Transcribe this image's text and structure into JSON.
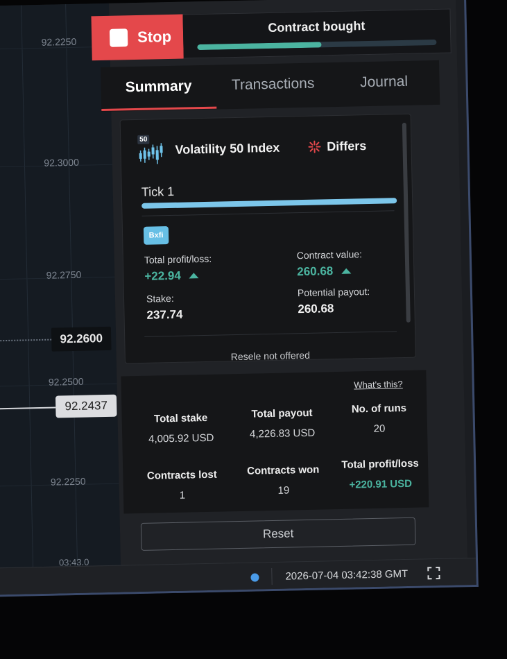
{
  "chart": {
    "price_ticks": [
      "92.2250",
      "92.3000",
      "92.2750",
      "92.2500",
      "92.2250"
    ],
    "current_price": "92.2600",
    "spot_price": "92.2437",
    "time_tick": "03:43.0"
  },
  "topbar": {
    "stop_label": "Stop",
    "status_text": "Contract bought",
    "progress": 0.52
  },
  "tabs": [
    {
      "label": "Summary",
      "active": true
    },
    {
      "label": "Transactions",
      "active": false
    },
    {
      "label": "Journal",
      "active": false
    }
  ],
  "contract": {
    "asset_badge": "50",
    "asset_name": "Volatility 50 Index",
    "trade_type": "Differs",
    "tick_label": "Tick 1",
    "type_chip": "Bxfi",
    "total_profit_label": "Total profit/loss:",
    "total_profit_value": "+22.94",
    "contract_value_label": "Contract value:",
    "contract_value": "260.68",
    "stake_label": "Stake:",
    "stake_value": "237.74",
    "payout_label": "Potential payout:",
    "payout_value": "260.68",
    "resale_text": "Resele not offered"
  },
  "stats": {
    "whats_this": "What's this?",
    "total_stake_label": "Total stake",
    "total_stake_value": "4,005.92 USD",
    "total_payout_label": "Total payout",
    "total_payout_value": "4,226.83 USD",
    "runs_label": "No. of runs",
    "runs_value": "20",
    "lost_label": "Contracts lost",
    "lost_value": "1",
    "won_label": "Contracts won",
    "won_value": "19",
    "profit_label": "Total profit/loss",
    "profit_value": "+220.91 USD"
  },
  "reset_label": "Reset",
  "footer": {
    "timestamp": "2026-07-04 03:42:38 GMT"
  },
  "colors": {
    "accent_red": "#e4484b",
    "profit_green": "#4bb4a0",
    "tick_blue": "#7cc6ea",
    "status_dot": "#4a9be8"
  }
}
